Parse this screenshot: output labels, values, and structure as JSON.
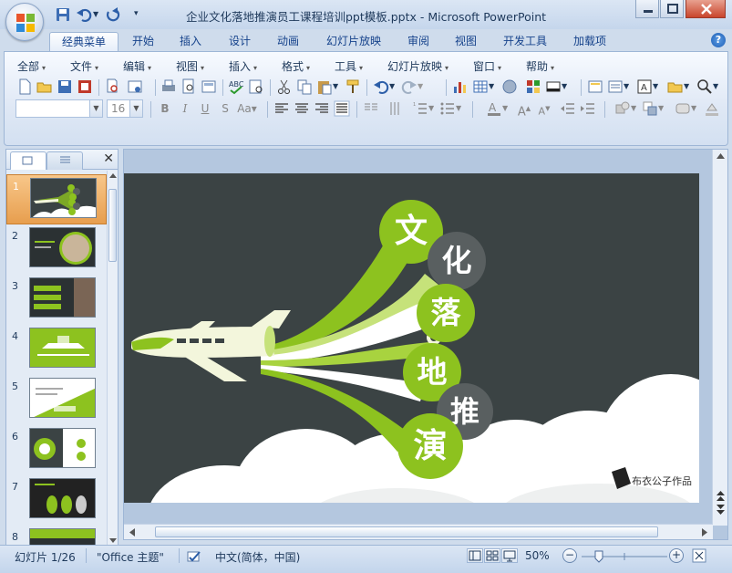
{
  "window": {
    "title": "企业文化落地推演员工课程培训ppt模板.pptx - Microsoft PowerPoint"
  },
  "ribbon_tabs": [
    {
      "label": "经典菜单"
    },
    {
      "label": "开始"
    },
    {
      "label": "插入"
    },
    {
      "label": "设计"
    },
    {
      "label": "动画"
    },
    {
      "label": "幻灯片放映"
    },
    {
      "label": "审阅"
    },
    {
      "label": "视图"
    },
    {
      "label": "开发工具"
    },
    {
      "label": "加载项"
    }
  ],
  "classic_menu": [
    {
      "label": "全部"
    },
    {
      "label": "文件"
    },
    {
      "label": "编辑"
    },
    {
      "label": "视图"
    },
    {
      "label": "插入"
    },
    {
      "label": "格式"
    },
    {
      "label": "工具"
    },
    {
      "label": "幻灯片放映"
    },
    {
      "label": "窗口"
    },
    {
      "label": "帮助"
    }
  ],
  "font": {
    "size": "16"
  },
  "thumbnails": [
    {
      "num": "1"
    },
    {
      "num": "2"
    },
    {
      "num": "3"
    },
    {
      "num": "4"
    },
    {
      "num": "5"
    },
    {
      "num": "6"
    },
    {
      "num": "7"
    },
    {
      "num": "8"
    }
  ],
  "slide": {
    "words": [
      "文",
      "化",
      "落",
      "地",
      "推",
      "演"
    ],
    "author": "布衣公子作品",
    "colors": {
      "background": "#3b4344",
      "accent_green": "#8dc21f",
      "grey_circle": "#595f60",
      "cloud": "#ffffff"
    }
  },
  "status": {
    "slide_info": "幻灯片 1/26",
    "theme": "\"Office 主题\"",
    "language": "中文(简体，中国)",
    "zoom": "50%"
  }
}
